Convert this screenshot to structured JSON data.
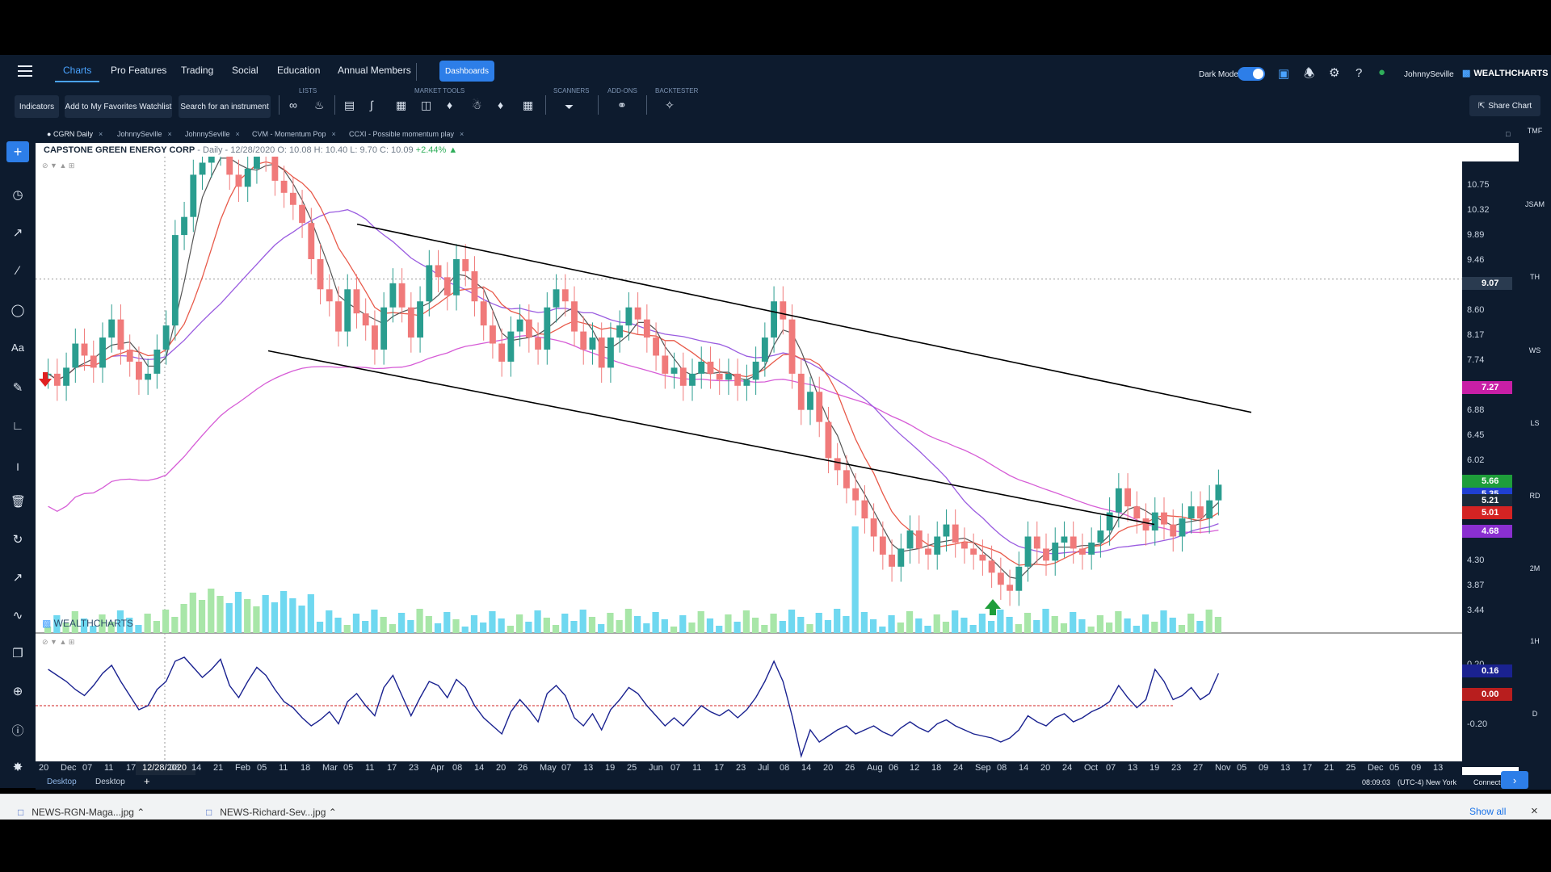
{
  "nav": {
    "tabs": [
      {
        "label": "Charts"
      },
      {
        "label": "Pro Features"
      },
      {
        "label": "Trading"
      },
      {
        "label": "Social"
      },
      {
        "label": "Education"
      },
      {
        "label": "Annual Members"
      }
    ],
    "dashboards_label": "Dashboards",
    "dark_mode_label": "Dark Mode",
    "dark_mode_on": true,
    "username": "JohnnySeville",
    "logo_text": "WEALTHCHARTS"
  },
  "toolbar": {
    "indicators_label": "Indicators",
    "watchlist_label": "Add to My Favorites Watchlist",
    "search_label": "Search for an instrument",
    "group_labels": {
      "lists": "LISTS",
      "market_tools": "MARKET TOOLS",
      "scanners": "SCANNERS",
      "add_ons": "ADD-ONS",
      "backtester": "BACKTESTER"
    },
    "share_label": "Share Chart"
  },
  "chart_tabs": [
    {
      "label": "CGRN Daily"
    },
    {
      "label": "JohnnySeville"
    },
    {
      "label": "JohnnySeville"
    },
    {
      "label": "CVM - Momentum Pop"
    },
    {
      "label": "CCXI - Possible momentum play"
    }
  ],
  "right_sidebar": [
    "TMF",
    "JSAM",
    "TH",
    "WS",
    "LS",
    "RD",
    "2M",
    "1H",
    "D"
  ],
  "legend": {
    "name": "CAPSTONE GREEN ENERGY CORP",
    "interval_date": " - Daily - 12/28/2020",
    "open": "O: 10.08",
    "high": "H: 10.40",
    "low": "L: 9.70",
    "close": "C: 10.09",
    "change": "+2.44%"
  },
  "watermark": "WEALTHCHARTS",
  "price_axis": {
    "ticks": [
      "10.75",
      "10.32",
      "9.89",
      "9.46",
      "8.60",
      "8.17",
      "7.74",
      "6.88",
      "6.45",
      "6.02",
      "4.30",
      "3.87",
      "3.44"
    ],
    "labels": [
      {
        "text": "9.07",
        "color": "#2a3b50"
      },
      {
        "text": "7.27",
        "color": "#c81fa6"
      },
      {
        "text": "5.66",
        "color": "#1e9e3a"
      },
      {
        "text": "5.35",
        "color": "#1f3fd1"
      },
      {
        "text": "5.21",
        "color": "#1a2a3a"
      },
      {
        "text": "5.01",
        "color": "#d42323"
      },
      {
        "text": "4.68",
        "color": "#8a2fd0"
      }
    ]
  },
  "oscillator_axis": {
    "ticks": [
      "0.20",
      "-0.20"
    ],
    "labels": [
      {
        "text": "0.16",
        "color": "#1a2290"
      },
      {
        "text": "0.00",
        "color": "#b81e1e"
      }
    ]
  },
  "time_axis": {
    "labels": [
      "20",
      "Dec",
      "07",
      "11",
      "17",
      "12/28/2020",
      "08",
      "14",
      "21",
      "Feb",
      "05",
      "11",
      "18",
      "Mar",
      "05",
      "11",
      "17",
      "23",
      "Apr",
      "08",
      "14",
      "20",
      "26",
      "May",
      "07",
      "13",
      "19",
      "25",
      "Jun",
      "07",
      "11",
      "17",
      "23",
      "Jul",
      "08",
      "14",
      "20",
      "26",
      "Aug",
      "06",
      "12",
      "18",
      "24",
      "Sep",
      "08",
      "14",
      "20",
      "24",
      "Oct",
      "07",
      "13",
      "19",
      "23",
      "27",
      "Nov",
      "05",
      "09",
      "13",
      "17",
      "21",
      "25",
      "Dec",
      "05",
      "09",
      "13"
    ]
  },
  "bottom_tabs": [
    "Desktop",
    "Desktop"
  ],
  "status": {
    "time": "08:09:03",
    "timezone": "(UTC-4) New York",
    "connection": "Connected"
  },
  "downloads": [
    {
      "name": "NEWS-RGN-Maga...jpg"
    },
    {
      "name": "NEWS-Richard-Sev...jpg"
    }
  ],
  "show_all_label": "Show all",
  "chart_data": {
    "type": "line",
    "y_range": [
      3.2,
      11.1
    ],
    "candle_closes": [
      7.5,
      7.3,
      7.6,
      8.0,
      7.8,
      7.6,
      8.1,
      8.4,
      7.9,
      7.7,
      7.4,
      7.5,
      7.9,
      8.3,
      9.8,
      10.1,
      10.8,
      11.0,
      11.2,
      11.3,
      10.8,
      10.6,
      10.9,
      11.2,
      11.1,
      10.7,
      10.5,
      10.3,
      10.0,
      9.4,
      8.9,
      8.7,
      8.2,
      8.9,
      8.5,
      8.3,
      7.9,
      8.6,
      9.0,
      8.6,
      8.1,
      8.7,
      9.3,
      9.1,
      8.8,
      9.4,
      9.2,
      8.7,
      8.3,
      8.0,
      7.7,
      8.2,
      8.4,
      8.1,
      7.9,
      8.6,
      8.9,
      8.7,
      8.2,
      7.9,
      8.1,
      7.6,
      8.1,
      8.3,
      8.6,
      8.4,
      8.1,
      7.8,
      7.5,
      7.6,
      7.3,
      7.5,
      7.7,
      7.5,
      7.4,
      7.5,
      7.3,
      7.4,
      7.7,
      8.1,
      8.7,
      8.4,
      7.5,
      6.9,
      7.2,
      6.7,
      6.1,
      5.9,
      5.6,
      5.4,
      5.1,
      4.8,
      4.5,
      4.3,
      4.6,
      4.9,
      4.6,
      4.5,
      4.8,
      5.0,
      4.7,
      4.6,
      4.5,
      4.4,
      4.2,
      4.0,
      3.9,
      4.3,
      4.8,
      4.6,
      4.4,
      4.7,
      4.8,
      4.6,
      4.5,
      4.7,
      4.9,
      5.2,
      5.6,
      5.3,
      5.1,
      4.9,
      5.2,
      5.0,
      4.8,
      5.1,
      5.3,
      5.1,
      5.4,
      5.66
    ],
    "oscillator": [
      0.18,
      0.15,
      0.12,
      0.08,
      0.05,
      0.1,
      0.16,
      0.2,
      0.12,
      0.05,
      -0.02,
      0.0,
      0.08,
      0.12,
      0.22,
      0.24,
      0.19,
      0.14,
      0.18,
      0.23,
      0.1,
      0.04,
      0.12,
      0.19,
      0.15,
      0.08,
      0.02,
      -0.01,
      -0.06,
      -0.1,
      -0.07,
      -0.03,
      -0.09,
      0.02,
      0.06,
      0.0,
      -0.05,
      0.09,
      0.15,
      0.05,
      -0.05,
      0.04,
      0.12,
      0.1,
      0.04,
      0.13,
      0.09,
      0.0,
      -0.06,
      -0.1,
      -0.14,
      -0.03,
      0.03,
      -0.02,
      -0.08,
      0.06,
      0.1,
      0.05,
      -0.06,
      -0.1,
      -0.04,
      -0.12,
      -0.02,
      0.03,
      0.09,
      0.06,
      0.0,
      -0.05,
      -0.1,
      -0.06,
      -0.1,
      -0.05,
      0.0,
      -0.03,
      -0.05,
      -0.02,
      -0.06,
      -0.02,
      0.04,
      0.12,
      0.22,
      0.12,
      -0.05,
      -0.25,
      -0.12,
      -0.18,
      -0.15,
      -0.12,
      -0.1,
      -0.14,
      -0.12,
      -0.1,
      -0.13,
      -0.15,
      -0.11,
      -0.08,
      -0.11,
      -0.13,
      -0.09,
      -0.07,
      -0.1,
      -0.12,
      -0.14,
      -0.15,
      -0.16,
      -0.18,
      -0.16,
      -0.12,
      -0.05,
      -0.08,
      -0.1,
      -0.06,
      -0.04,
      -0.08,
      -0.06,
      -0.03,
      -0.01,
      0.02,
      0.1,
      0.04,
      -0.01,
      0.03,
      0.18,
      0.12,
      0.03,
      0.05,
      0.09,
      0.03,
      0.06,
      0.16
    ]
  }
}
